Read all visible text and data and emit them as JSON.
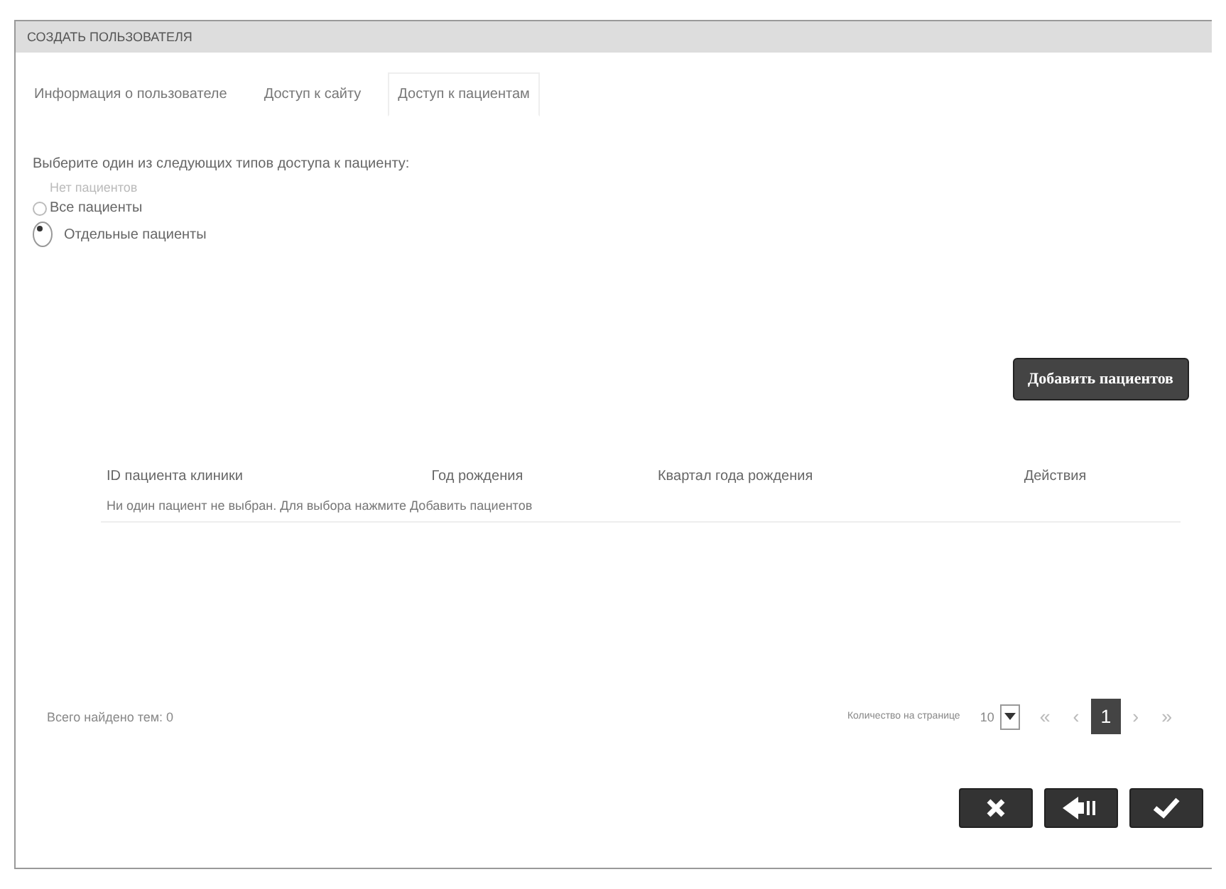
{
  "window": {
    "title": "СОЗДАТЬ ПОЛЬЗОВАТЕЛЯ"
  },
  "tabs": [
    {
      "label": "Информация о пользователе",
      "selected": false
    },
    {
      "label": "Доступ к сайту",
      "selected": false
    },
    {
      "label": "Доступ к пациентам",
      "selected": true
    }
  ],
  "access": {
    "prompt": "Выберите один из следующих типов доступа к пациенту:",
    "options": [
      {
        "label": "Нет пациентов",
        "selected": false,
        "disabled": true
      },
      {
        "label": "Все пациенты",
        "selected": false,
        "disabled": false
      },
      {
        "label": "Отдельные пациенты",
        "selected": true,
        "disabled": false
      }
    ]
  },
  "add_button": "Добавить пациентов",
  "table": {
    "columns": [
      "ID пациента клиники",
      "Год рождения",
      "Квартал года рождения",
      "Действия"
    ],
    "empty_message": "Ни один пациент не выбран. Для выбора нажмите Добавить пациентов"
  },
  "footer": {
    "total": "Всего найдено тем: 0",
    "per_page_label": "Количество на странице",
    "per_page": "10",
    "pages": [
      {
        "label": "«",
        "selected": false
      },
      {
        "label": "‹",
        "selected": false
      },
      {
        "label": "1",
        "selected": true
      },
      {
        "label": "›",
        "selected": false
      },
      {
        "label": "»",
        "selected": false
      }
    ]
  },
  "actions": [
    {
      "kind": "cancel"
    },
    {
      "kind": "back"
    },
    {
      "kind": "save"
    }
  ]
}
